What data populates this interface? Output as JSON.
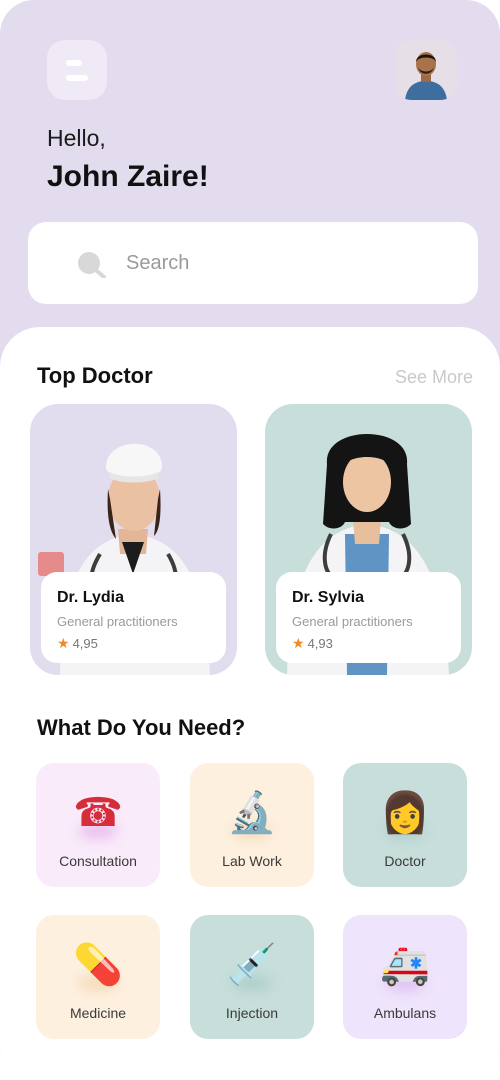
{
  "header": {
    "greeting": "Hello,",
    "username": "John Zaire!"
  },
  "search": {
    "placeholder": "Search"
  },
  "top_doctor": {
    "title": "Top Doctor",
    "see_more": "See More",
    "doctors": [
      {
        "name": "Dr. Lydia",
        "role": "General practitioners",
        "rating": "4,95"
      },
      {
        "name": "Dr. Sylvia",
        "role": "General practitioners",
        "rating": "4,93"
      }
    ]
  },
  "needs": {
    "title": "What Do You Need?",
    "items": [
      {
        "label": "Consultation",
        "icon": "telephone-icon",
        "glyph": "☎",
        "bg": "#f9ebfa",
        "glyph_color": "#d62d3a"
      },
      {
        "label": "Lab Work",
        "icon": "microscope-icon",
        "glyph": "🔬",
        "bg": "#fdf0df",
        "glyph_color": "#7a7f8a"
      },
      {
        "label": "Doctor",
        "icon": "doctor-icon",
        "glyph": "👩",
        "bg": "#c7dedb",
        "glyph_color": "#e8a640"
      },
      {
        "label": "Medicine",
        "icon": "pill-icon",
        "glyph": "💊",
        "bg": "#fdf0df",
        "glyph_color": "#e0312e"
      },
      {
        "label": "Injection",
        "icon": "syringe-icon",
        "glyph": "💉",
        "bg": "#c7dedb",
        "glyph_color": "#c53b3b"
      },
      {
        "label": "Ambulans",
        "icon": "ambulance-icon",
        "glyph": "🚑",
        "bg": "#eee4fb",
        "glyph_color": "#d93a3a"
      }
    ]
  },
  "colors": {
    "header_bg": "#e3dcee",
    "star": "#f08a24",
    "see_more": "#c9c9c9"
  }
}
